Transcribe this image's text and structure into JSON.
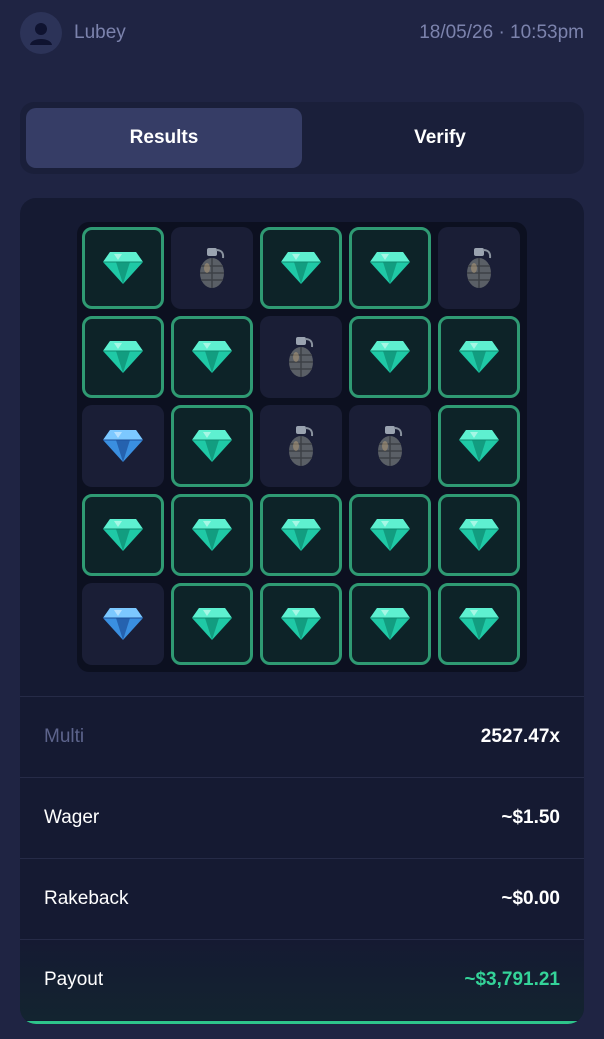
{
  "header": {
    "username": "Lubey",
    "timestamp": "18/05/26 · 10:53pm"
  },
  "tabs": [
    {
      "label": "Results",
      "active": true
    },
    {
      "label": "Verify",
      "active": false
    }
  ],
  "board": {
    "rows": 5,
    "cols": 5,
    "tiles": [
      [
        "gem",
        "mine",
        "gem",
        "gem",
        "mine"
      ],
      [
        "gem",
        "gem",
        "mine",
        "gem",
        "gem"
      ],
      [
        "gem-blue",
        "gem",
        "mine",
        "mine",
        "gem"
      ],
      [
        "gem",
        "gem",
        "gem",
        "gem",
        "gem"
      ],
      [
        "gem-blue",
        "gem",
        "gem",
        "gem",
        "gem"
      ]
    ],
    "revealed": [
      [
        true,
        false,
        true,
        true,
        false
      ],
      [
        true,
        true,
        false,
        true,
        true
      ],
      [
        false,
        true,
        false,
        false,
        true
      ],
      [
        true,
        true,
        true,
        true,
        true
      ],
      [
        false,
        true,
        true,
        true,
        true
      ]
    ]
  },
  "stats": {
    "multi": {
      "label": "Multi",
      "value": "2527.47x"
    },
    "wager": {
      "label": "Wager",
      "value": "~$1.50"
    },
    "rakeback": {
      "label": "Rakeback",
      "value": "~$0.00"
    },
    "payout": {
      "label": "Payout",
      "value": "~$3,791.21"
    }
  },
  "colors": {
    "accent_green": "#34d399",
    "tile_border": "#2f9a73",
    "background": "#1f2443"
  }
}
